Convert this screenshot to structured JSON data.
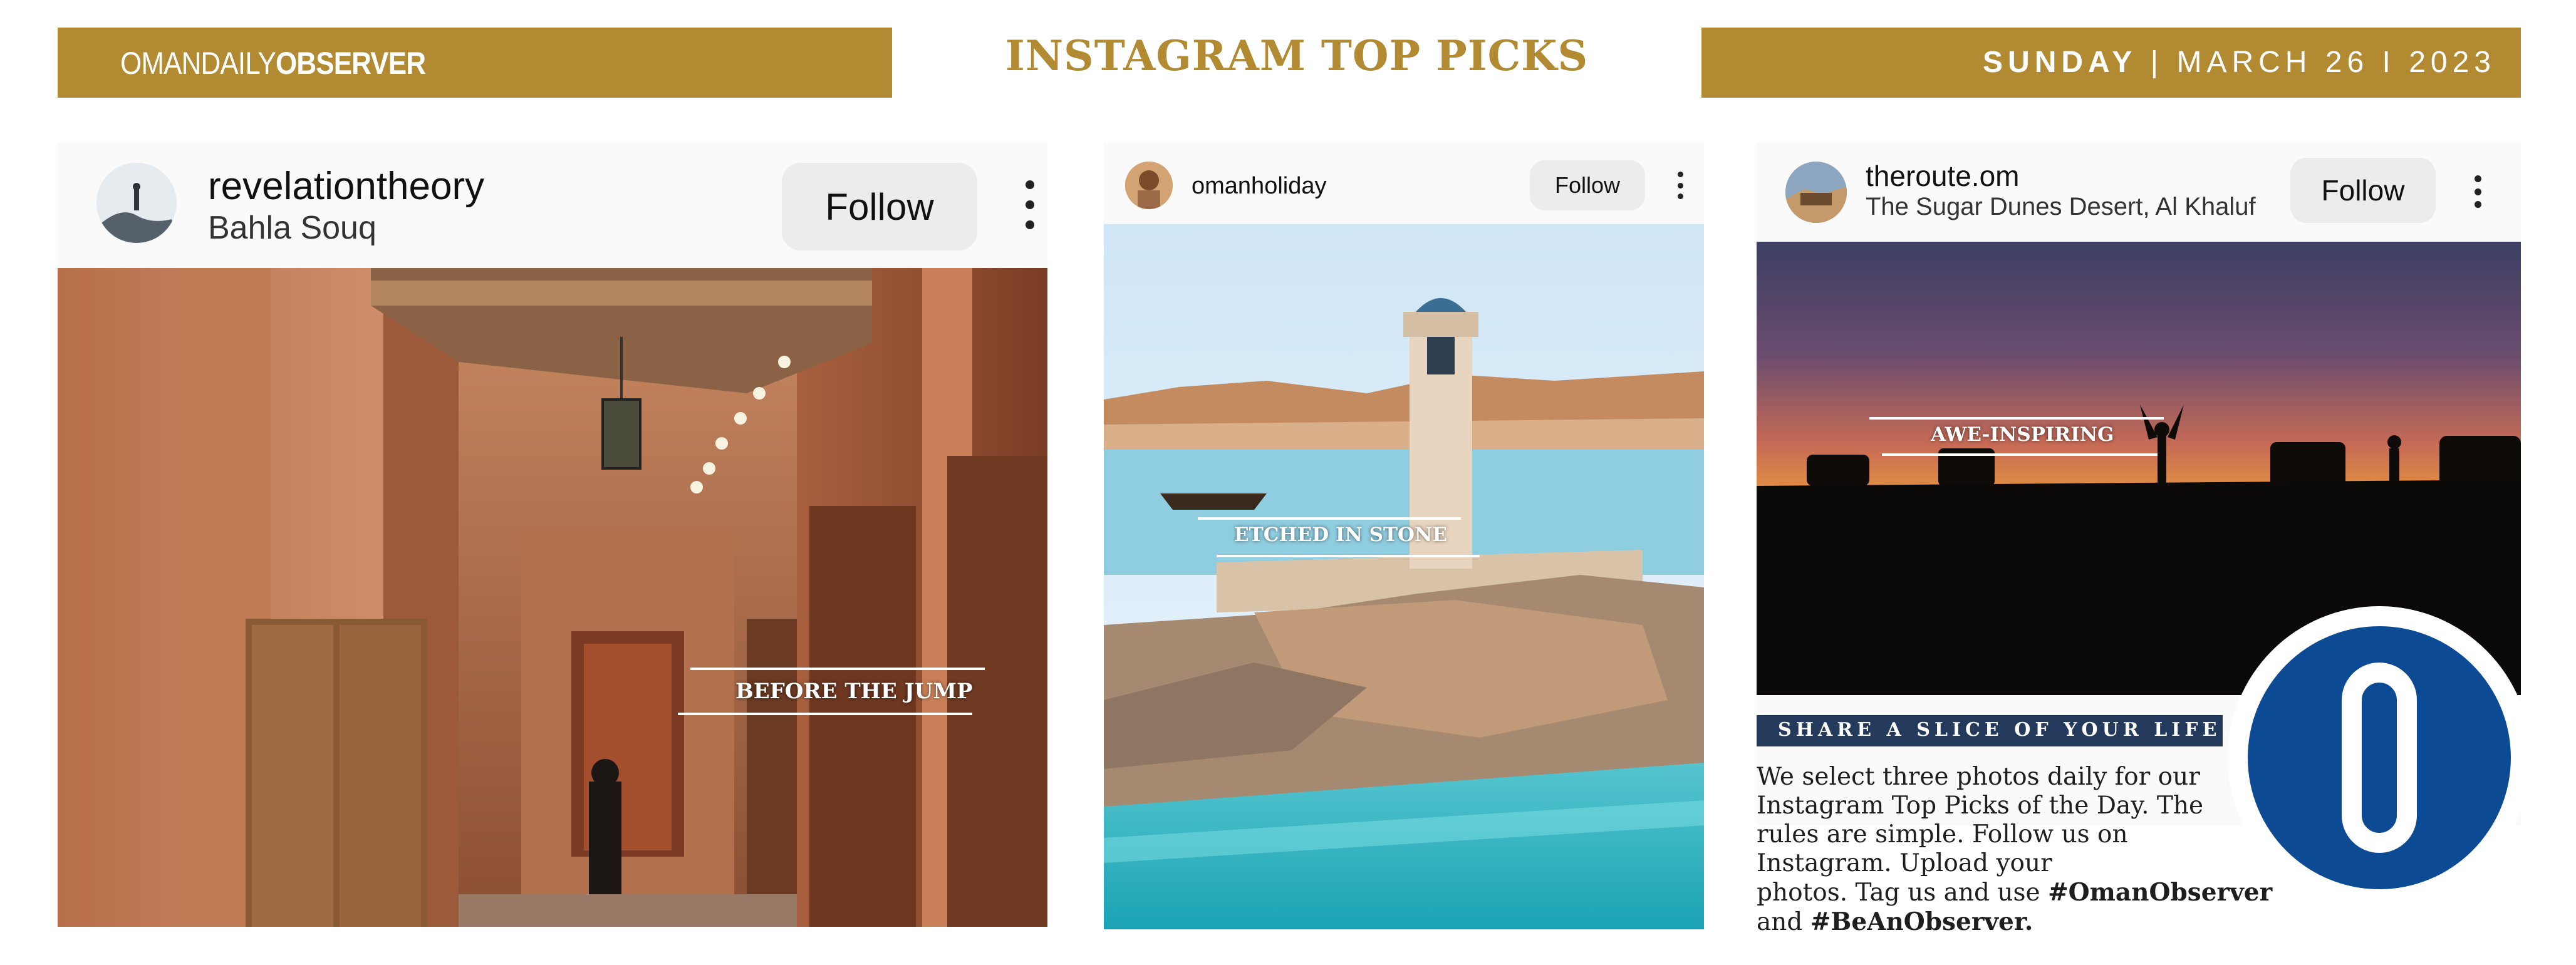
{
  "masthead": {
    "brand_light": "OMANDAILY",
    "brand_bold": "OBSERVER",
    "section_title": "INSTAGRAM TOP PICKS",
    "day": "SUNDAY",
    "separator": "|",
    "month_day": "MARCH 26",
    "separator2": "I",
    "year": "2023",
    "accent_color": "#b18a32"
  },
  "posts": [
    {
      "username": "revelationtheory",
      "location": "Bahla Souq",
      "follow_label": "Follow",
      "more_icon": "more-vertical-icon",
      "caption": "BEFORE THE JUMP"
    },
    {
      "username": "omanholiday",
      "location": "",
      "follow_label": "Follow",
      "more_icon": "more-vertical-icon",
      "caption": "ETCHED IN STONE"
    },
    {
      "username": "theroute.om",
      "location": "The Sugar Dunes Desert, Al Khaluf",
      "follow_label": "Follow",
      "more_icon": "more-vertical-icon",
      "caption": "AWE-INSPIRING"
    }
  ],
  "share": {
    "heading": "SHARE A SLICE OF YOUR LIFE",
    "line1": "We select three photos daily for our",
    "line2": "Instagram Top Picks of the Day. The",
    "line3": "rules are simple. Follow us on",
    "line4": "Instagram. Upload your",
    "line5_text": "photos. Tag us and use ",
    "hashtag1": "#OmanObserver",
    "line6_text": "and ",
    "hashtag2": "#BeAnObserver.",
    "heading_color": "#243a5c"
  },
  "logo": {
    "letter": "O",
    "color": "#0c4a93"
  }
}
